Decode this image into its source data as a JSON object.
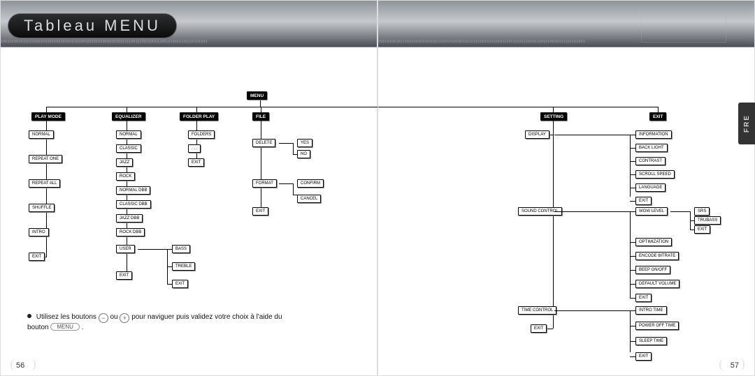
{
  "title": "Tableau MENU",
  "binaryStrip": "1001010010110101001010010101010101010010110101001010101011100111001100101001010010101110101001",
  "sideTab": "FRE",
  "pages": {
    "left": "56",
    "right": "57"
  },
  "root": "MENU",
  "topMenus": [
    "PLAY MODE",
    "EQUALIZER",
    "FOLDER PLAY",
    "FILE",
    "SETTING",
    "EXIT"
  ],
  "playMode": [
    "NORMAL",
    "REPEAT ONE",
    "REPEAT ALL",
    "SHUFFLE",
    "INTRO",
    "EXIT"
  ],
  "equalizer": [
    "NORMAL",
    "CLASSIC",
    "JAZZ",
    "ROCK",
    "NORMAL DBB",
    "CLASSIC DBB",
    "JAZZ DBB",
    "ROCK DBB",
    "USER",
    "EXIT"
  ],
  "eqUser": [
    "BASS",
    "TREBLE",
    "EXIT"
  ],
  "folderPlay": [
    "FOLDERS",
    ". . .",
    "EXIT"
  ],
  "file": [
    "DELETE",
    "FORMAT",
    "EXIT"
  ],
  "fileDelete": [
    "YES",
    "NO"
  ],
  "fileFormat": [
    "CONFIRM",
    "CANCEL"
  ],
  "setting": [
    "DISPLAY",
    "SOUND CONTROL",
    "TIME CONTROL",
    "EXIT"
  ],
  "display": [
    "INFORMATION",
    "BACK LIGHT",
    "CONTRAST",
    "SCROLL SPEED",
    "LANGUAGE",
    "EXIT"
  ],
  "soundControl": [
    "WOW LEVEL",
    "OPTIMIZATION",
    "ENCODE BITRATE",
    "BEEP ON/OFF",
    "DEFAULT VOLUME",
    "EXIT"
  ],
  "wowLevel": [
    "SRS",
    "TRUBASS",
    "EXIT"
  ],
  "timeControl": [
    "INTRO TIME",
    "POWER OFF TIME",
    "SLEEP TIME",
    "EXIT"
  ],
  "hint": {
    "pre": "Utilisez les boutons",
    "mid": "ou",
    "post": "pour naviguer puis validez votre choix à l'aide du",
    "post2": "bouton",
    "btn": "MENU",
    "minus": "−",
    "plus": "+"
  }
}
